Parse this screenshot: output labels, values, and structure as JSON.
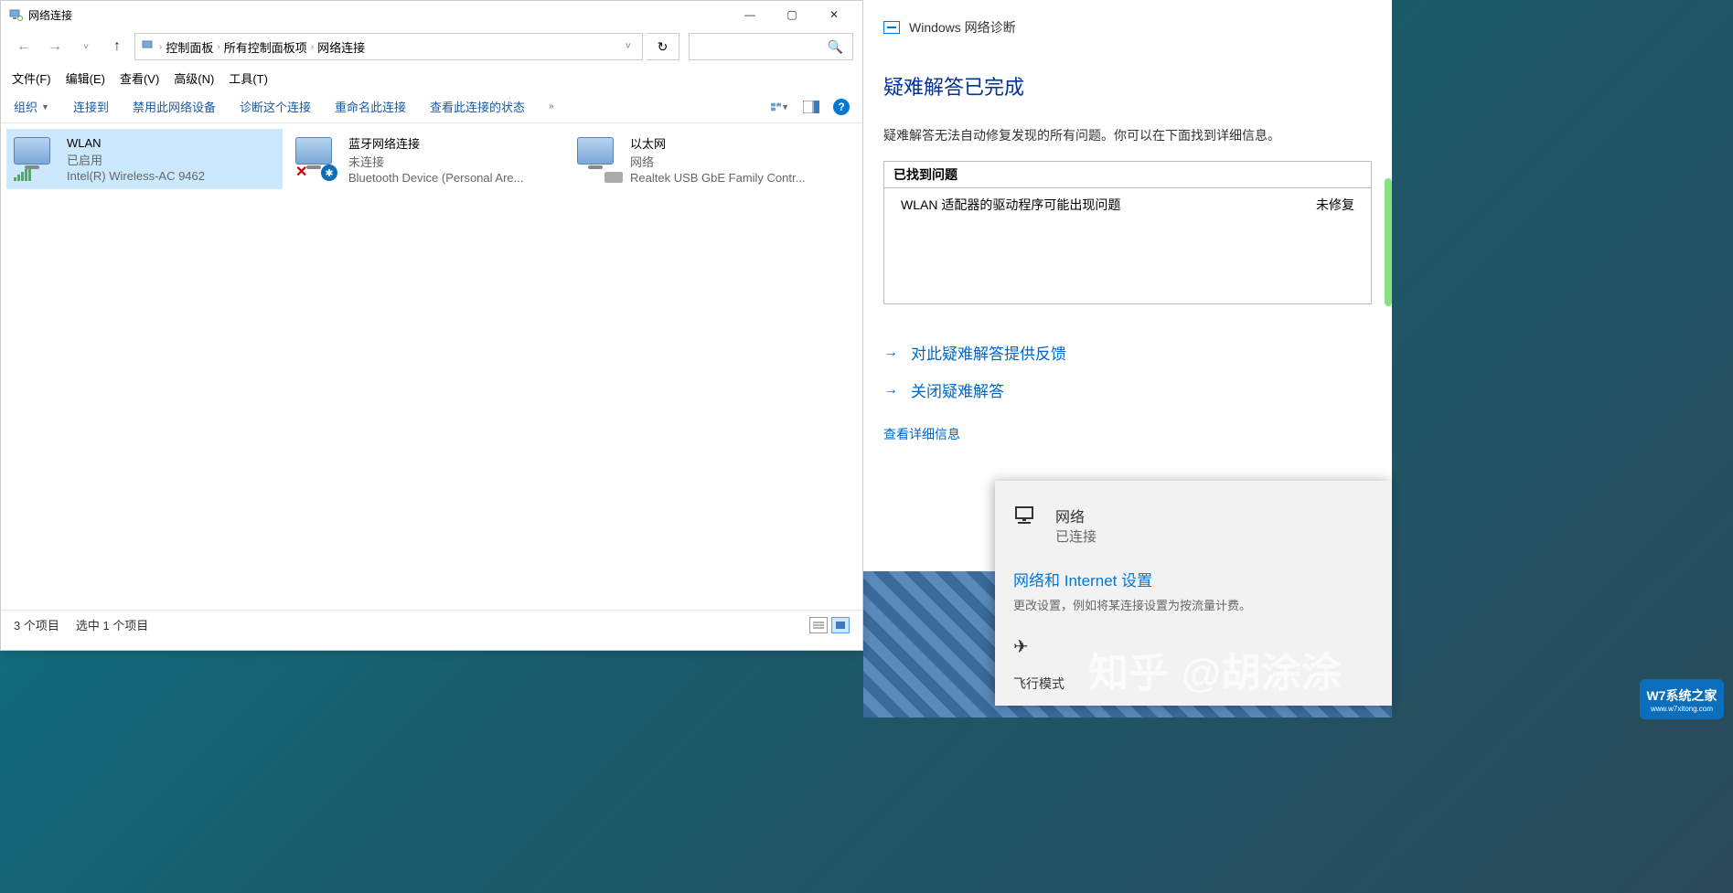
{
  "window": {
    "title": "网络连接",
    "controls": {
      "min": "—",
      "max": "▢",
      "close": "✕"
    }
  },
  "nav": {
    "back": "←",
    "forward": "→",
    "recent_drop": "˅",
    "up": "↑",
    "breadcrumbs": [
      "控制面板",
      "所有控制面板项",
      "网络连接"
    ],
    "addr_drop": "˅",
    "refresh": "↻",
    "search_icon": "🔍"
  },
  "menu": {
    "file": "文件(F)",
    "edit": "编辑(E)",
    "view": "查看(V)",
    "advanced": "高级(N)",
    "tools": "工具(T)"
  },
  "toolbar": {
    "organize": "组织",
    "connect": "连接到",
    "disable": "禁用此网络设备",
    "diagnose": "诊断这个连接",
    "rename": "重命名此连接",
    "view_status": "查看此连接的状态",
    "overflow": "»",
    "help": "?"
  },
  "connections": [
    {
      "name": "WLAN",
      "status": "已启用",
      "device": "Intel(R) Wireless-AC 9462",
      "type": "wifi",
      "selected": true
    },
    {
      "name": "蓝牙网络连接",
      "status": "未连接",
      "device": "Bluetooth Device (Personal Are...",
      "type": "bluetooth",
      "selected": false
    },
    {
      "name": "以太网",
      "status": "网络",
      "device": "Realtek USB GbE Family Contr...",
      "type": "ethernet",
      "selected": false
    }
  ],
  "status_bar": {
    "count": "3 个项目",
    "selected": "选中 1 个项目"
  },
  "troubleshooter": {
    "header": "Windows 网络诊断",
    "h1": "疑难解答已完成",
    "body": "疑难解答无法自动修复发现的所有问题。你可以在下面找到详细信息。",
    "problems_head": "已找到问题",
    "problem": "WLAN 适配器的驱动程序可能出现问题",
    "problem_status": "未修复",
    "action_feedback": "对此疑难解答提供反馈",
    "action_close": "关闭疑难解答",
    "details": "查看详细信息"
  },
  "flyout": {
    "net_name": "网络",
    "net_status": "已连接",
    "settings_title": "网络和 Internet 设置",
    "settings_sub": "更改设置，例如将某连接设置为按流量计费。",
    "airplane": "飞行模式"
  },
  "watermark": {
    "site": "知乎",
    "author": "@胡涂涂",
    "badge": "W7系统之家",
    "badge_url": "www.w7xitong.com"
  }
}
